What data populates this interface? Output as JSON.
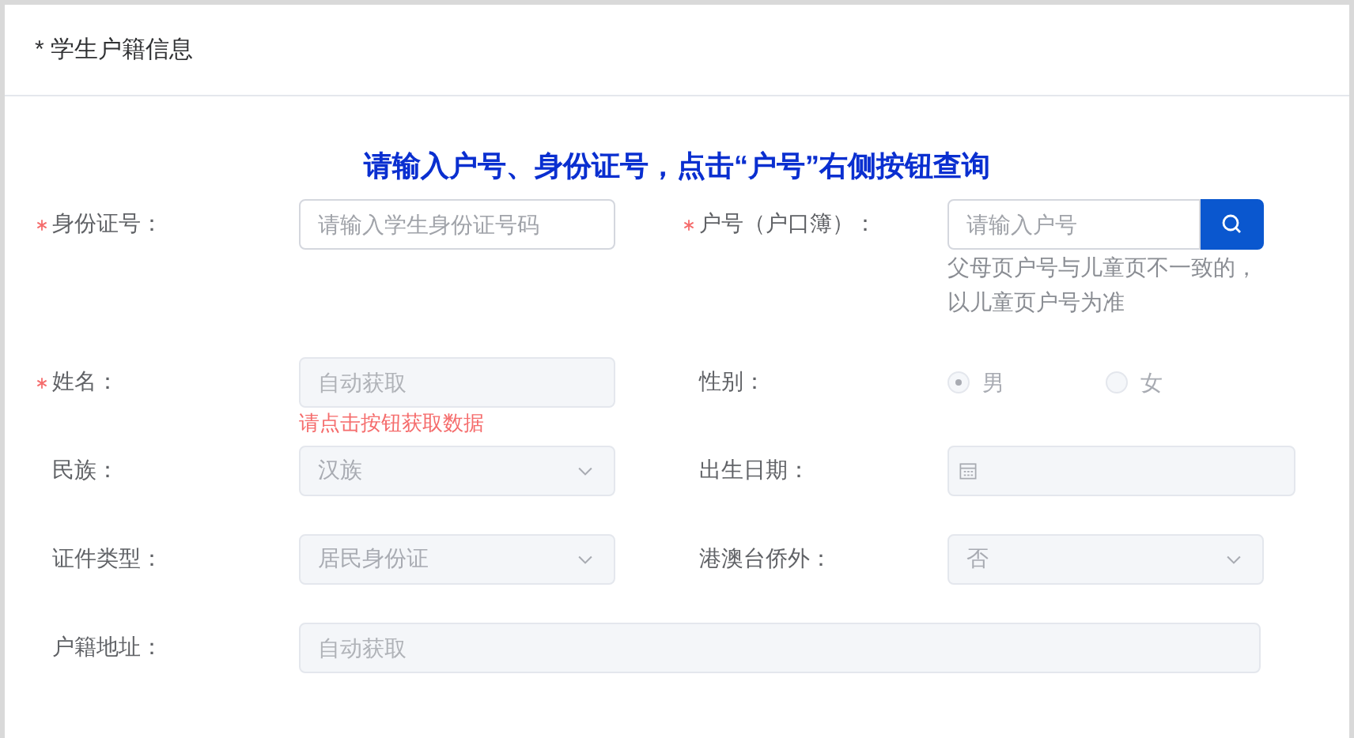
{
  "card": {
    "title": "* 学生户籍信息"
  },
  "notice": "请输入户号、身份证号，点击“户号”右侧按钮查询",
  "rows": [
    {
      "fields": [
        {
          "kind": "input",
          "label": "身份证号：",
          "required": true,
          "disabled": false,
          "placeholder": "请输入学生身份证号码"
        },
        {
          "kind": "search",
          "label": "户号（户口簿）：",
          "required": true,
          "disabled": false,
          "placeholder": "请输入户号",
          "hint": [
            "父母页户号与儿童页不一致的，",
            "以儿童页户号为准"
          ]
        }
      ]
    },
    {
      "fields": [
        {
          "kind": "input",
          "label": "姓名：",
          "required": true,
          "disabled": true,
          "placeholder": "自动获取",
          "error": "请点击按钮获取数据"
        },
        {
          "kind": "radio",
          "label": "性别：",
          "required": false,
          "disabled": true,
          "options": [
            {
              "label": "男",
              "selected": true
            },
            {
              "label": "女",
              "selected": false
            }
          ]
        }
      ]
    },
    {
      "fields": [
        {
          "kind": "select",
          "label": "民族：",
          "required": false,
          "disabled": true,
          "value": "汉族"
        },
        {
          "kind": "date",
          "label": "出生日期：",
          "required": false,
          "disabled": true
        }
      ]
    },
    {
      "fields": [
        {
          "kind": "select",
          "label": "证件类型：",
          "required": false,
          "disabled": true,
          "value": "居民身份证"
        },
        {
          "kind": "select",
          "label": "港澳台侨外：",
          "required": false,
          "disabled": true,
          "value": "否"
        }
      ]
    },
    {
      "fields": [
        {
          "kind": "wide",
          "label": "户籍地址：",
          "required": false,
          "disabled": true,
          "placeholder": "自动获取"
        }
      ]
    }
  ]
}
